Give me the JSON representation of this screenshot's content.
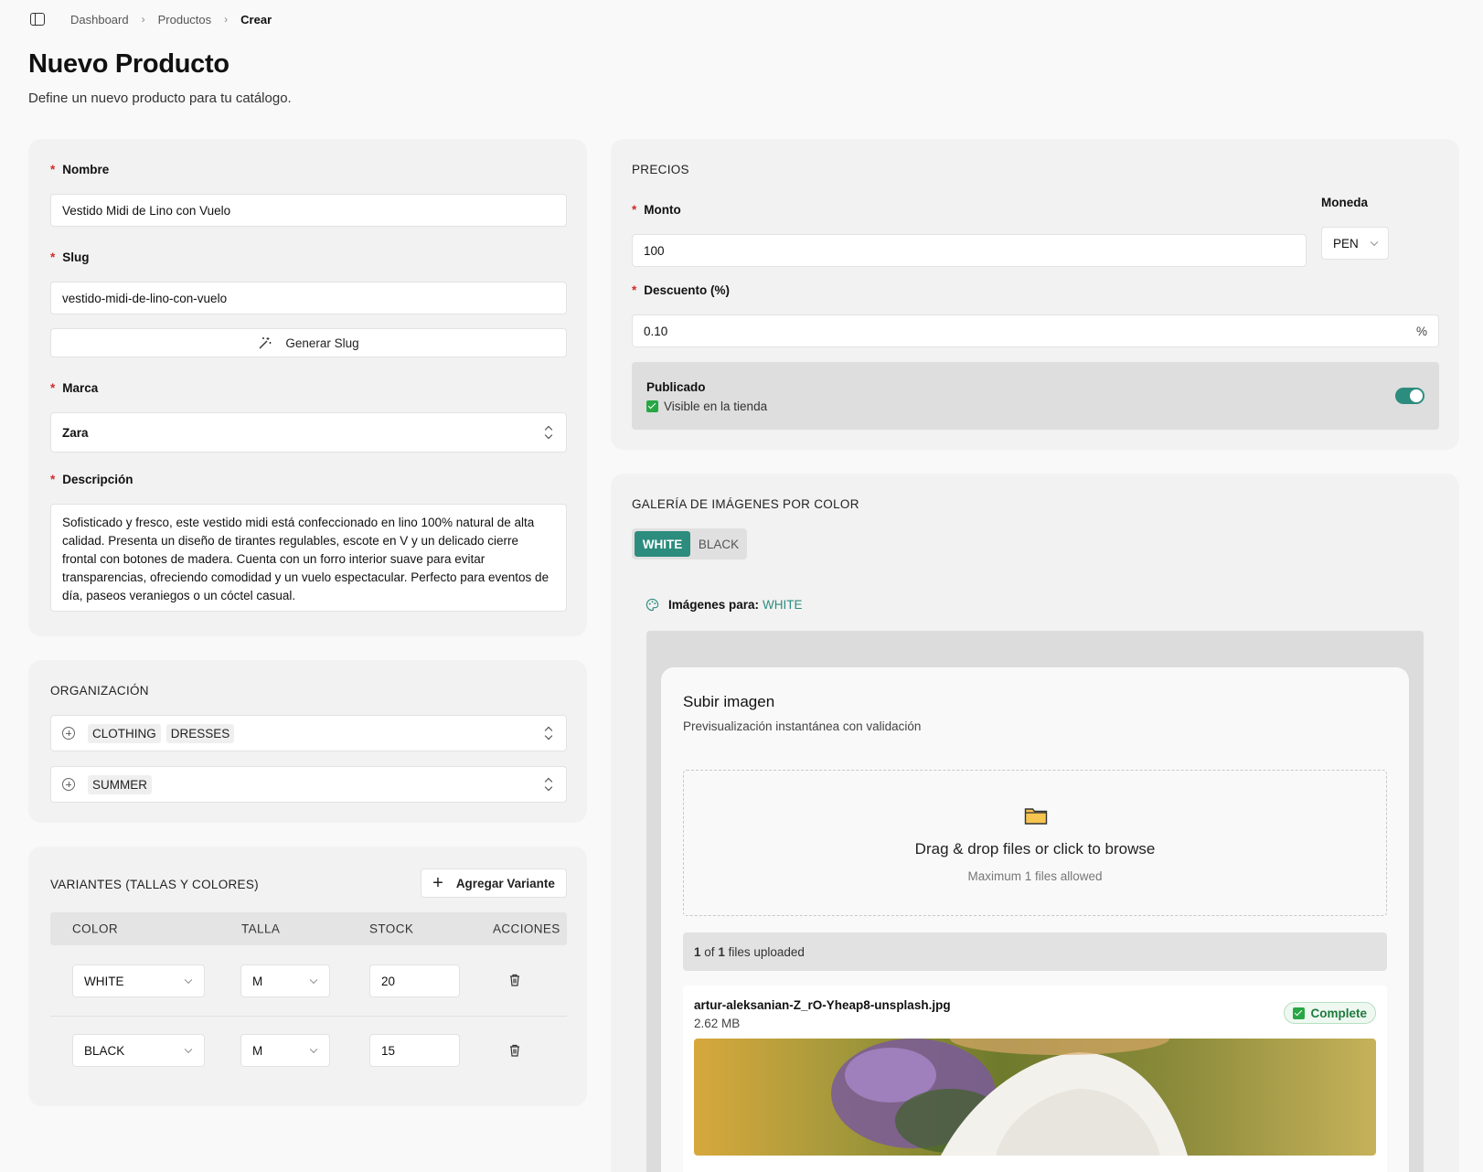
{
  "breadcrumb": {
    "items": [
      "Dashboard",
      "Productos"
    ],
    "current": "Crear"
  },
  "page": {
    "title": "Nuevo Producto",
    "subtitle": "Define un nuevo producto para tu catálogo."
  },
  "general": {
    "name_label": "Nombre",
    "name_value": "Vestido Midi de Lino con Vuelo",
    "slug_label": "Slug",
    "slug_value": "vestido-midi-de-lino-con-vuelo",
    "generate_slug": "Generar Slug",
    "brand_label": "Marca",
    "brand_value": "Zara",
    "description_label": "Descripción",
    "description_value": "Sofisticado y fresco, este vestido midi está confeccionado en lino 100% natural de alta calidad. Presenta un diseño de tirantes regulables, escote en V y un delicado cierre frontal con botones de madera. Cuenta con un forro interior suave para evitar transparencias, ofreciendo comodidad y un vuelo espectacular. Perfecto para eventos de día, paseos veraniegos o un cóctel casual."
  },
  "organization": {
    "title": "ORGANIZACIÓN",
    "categories": [
      "CLOTHING",
      "DRESSES"
    ],
    "tags": [
      "SUMMER"
    ]
  },
  "variants": {
    "title": "VARIANTES (TALLAS Y COLORES)",
    "add_button": "Agregar Variante",
    "columns": [
      "COLOR",
      "TALLA",
      "STOCK",
      "ACCIONES"
    ],
    "rows": [
      {
        "color": "WHITE",
        "size": "M",
        "stock": "20"
      },
      {
        "color": "BLACK",
        "size": "M",
        "stock": "15"
      }
    ]
  },
  "pricing": {
    "title": "PRECIOS",
    "amount_label": "Monto",
    "amount_value": "100",
    "currency_label": "Moneda",
    "currency_value": "PEN",
    "discount_label": "Descuento (%)",
    "discount_value": "0.10",
    "discount_suffix": "%",
    "published_label": "Publicado",
    "published_hint": "Visible en la tienda",
    "published": true
  },
  "gallery": {
    "title": "GALERÍA DE IMÁGENES POR COLOR",
    "tabs": [
      "WHITE",
      "BLACK"
    ],
    "active_tab": "WHITE",
    "images_for_label": "Imágenes para:",
    "images_for_value": "WHITE",
    "upload_title": "Subir imagen",
    "upload_subtitle": "Previsualización instantánea con validación",
    "dropzone_text": "Drag & drop files or click to browse",
    "dropzone_hint": "Maximum 1 files allowed",
    "uploaded_count": "1",
    "uploaded_total": "1",
    "uploaded_of": "of",
    "uploaded_suffix": "files uploaded",
    "file_name": "artur-aleksanian-Z_rO-Yheap8-unsplash.jpg",
    "file_size": "2.62 MB",
    "file_status": "Complete"
  },
  "colors": {
    "accent": "#2c8c7e",
    "required": "#d02c2c",
    "success": "#28a745"
  }
}
